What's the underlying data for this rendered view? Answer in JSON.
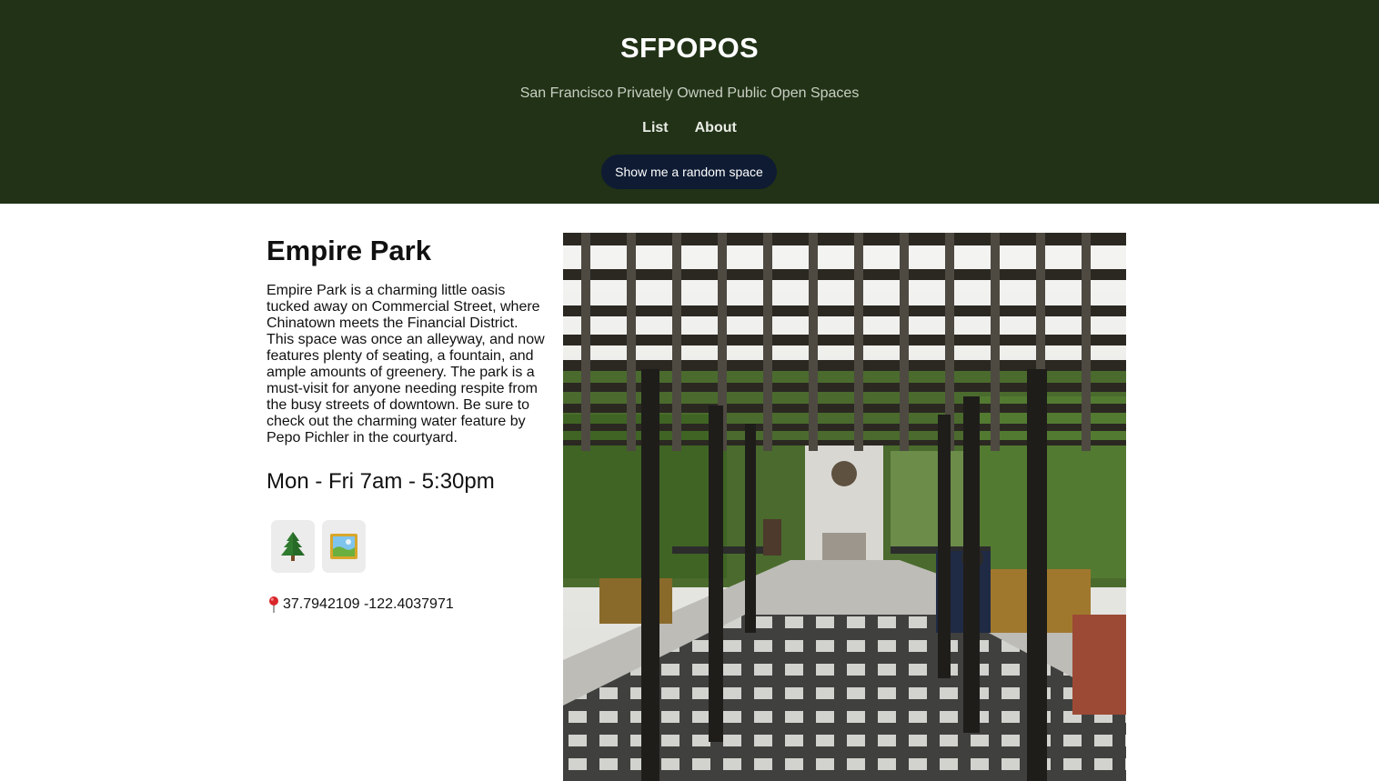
{
  "header": {
    "title": "SFPOPOS",
    "subtitle": "San Francisco Privately Owned Public Open Spaces",
    "nav": [
      {
        "label": "List"
      },
      {
        "label": "About"
      }
    ],
    "random_button_label": "Show me a random space"
  },
  "space": {
    "name": "Empire Park",
    "description": "Empire Park is a charming little oasis tucked away on Commercial Street, where Chinatown meets the Financial District. This space was once an alleyway, and now features plenty of seating, a fountain, and ample amounts of greenery. The park is a must-visit for anyone needing respite from the busy streets of downtown. Be sure to check out the charming water feature by Pepo Pichler in the courtyard.",
    "hours": "Mon - Fri 7am - 5:30pm",
    "features": [
      {
        "icon": "tree-icon"
      },
      {
        "icon": "framed-picture-icon"
      }
    ],
    "location": {
      "icon": "round-pushpin-icon",
      "coordinates": "37.7942109 -122.4037971"
    },
    "photo": {
      "subject": "pergola walkway leading to a courtyard fountain"
    }
  },
  "colors": {
    "header_bg": "#213216",
    "button_bg": "#0e1b33",
    "feature_bg": "#ececec"
  }
}
